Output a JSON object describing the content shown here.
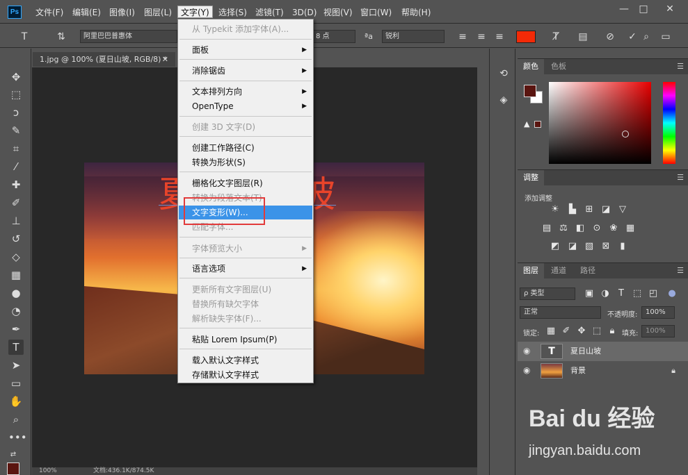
{
  "app": {
    "logo": "Ps"
  },
  "menubar": {
    "items": [
      "文件(F)",
      "编辑(E)",
      "图像(I)",
      "图层(L)",
      "文字(Y)",
      "选择(S)",
      "滤镜(T)",
      "3D(D)",
      "视图(V)",
      "窗口(W)",
      "帮助(H)"
    ],
    "active": "文字(Y)"
  },
  "window_controls": {
    "minimize": "—",
    "maximize": "□",
    "close": "✕"
  },
  "options_bar": {
    "font_family": "阿里巴巴普惠体",
    "font_size": "8 点",
    "antialias": "锐利",
    "text_color": "#f32a07"
  },
  "document": {
    "tab_title": "1.jpg @ 100% (夏日山坡, RGB/8) *",
    "tab_close": "✕",
    "overlay_text_left": "夏",
    "overlay_text_right": "坡",
    "zoom": "100%",
    "doc_info": "文档:436.1K/874.5K"
  },
  "type_menu": {
    "items": [
      {
        "label": "从 Typekit 添加字体(A)...",
        "disabled": true
      },
      {
        "label": "面板",
        "submenu": true
      },
      {
        "label": "消除锯齿",
        "submenu": true
      },
      {
        "label": "文本排列方向",
        "submenu": true
      },
      {
        "label": "OpenType",
        "submenu": true
      },
      {
        "label": "创建 3D 文字(D)",
        "disabled": true
      },
      {
        "label": "创建工作路径(C)"
      },
      {
        "label": "转换为形状(S)"
      },
      {
        "label": "栅格化文字图层(R)"
      },
      {
        "label": "转换为段落文本(T)",
        "disabled": true
      },
      {
        "label": "文字变形(W)...",
        "highlighted": true
      },
      {
        "label": "匹配字体...",
        "disabled": true
      },
      {
        "label": "字体预览大小",
        "submenu": true,
        "disabled": true
      },
      {
        "label": "语言选项",
        "submenu": true
      },
      {
        "label": "更新所有文字图层(U)",
        "disabled": true
      },
      {
        "label": "替换所有缺欠字体",
        "disabled": true
      },
      {
        "label": "解析缺失字体(F)...",
        "disabled": true
      },
      {
        "label": "粘贴 Lorem Ipsum(P)"
      },
      {
        "label": "载入默认文字样式"
      },
      {
        "label": "存储默认文字样式"
      }
    ]
  },
  "color_panel": {
    "tabs": [
      "颜色",
      "色板"
    ],
    "foreground": "#5a1510",
    "background": "#ffffff"
  },
  "adjustments_panel": {
    "tab": "调整",
    "heading": "添加调整"
  },
  "layers_panel": {
    "tabs": [
      "图层",
      "通道",
      "路径"
    ],
    "filter_label": "ρ 类型",
    "blend_mode": "正常",
    "opacity_label": "不透明度:",
    "opacity_value": "100%",
    "lock_label": "锁定:",
    "fill_label": "填充:",
    "fill_value": "100%",
    "layers": [
      {
        "name": "夏日山坡",
        "type": "text",
        "selected": true
      },
      {
        "name": "背景",
        "type": "image",
        "locked": true
      }
    ]
  },
  "watermark": {
    "brand": "Bai du 经验",
    "url": "jingyan.baidu.com"
  }
}
